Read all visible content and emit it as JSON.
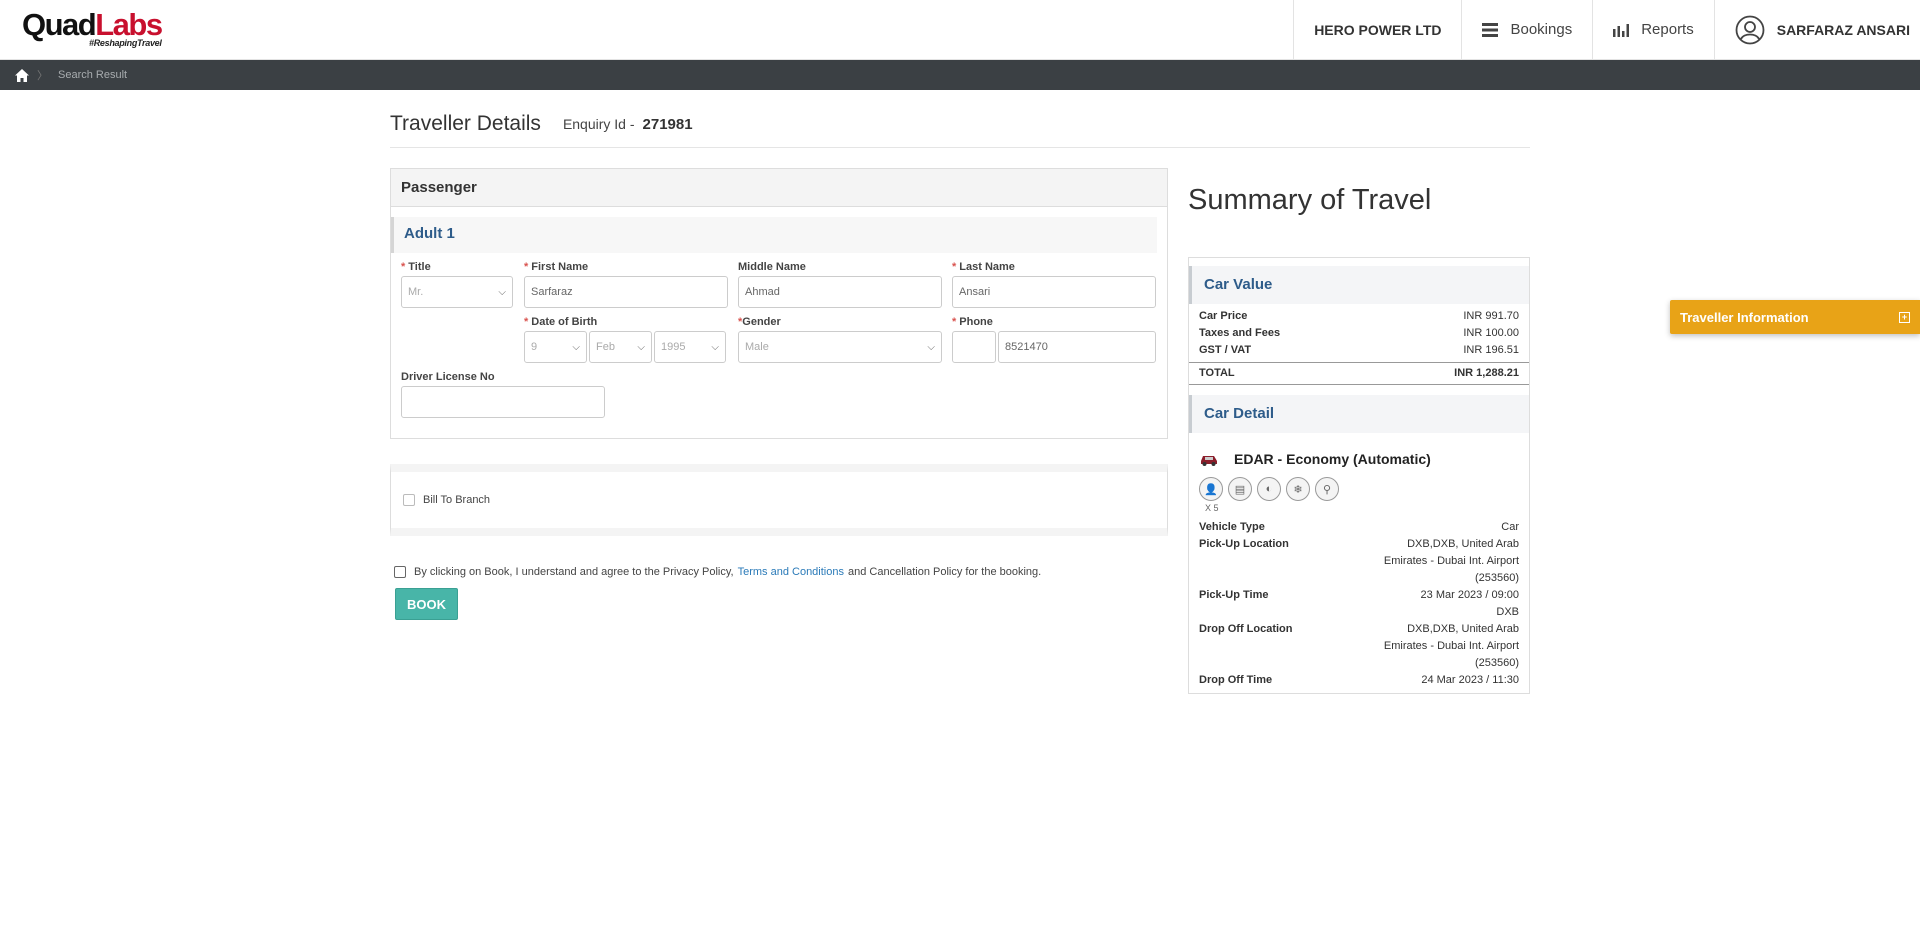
{
  "brand": {
    "logo_main": "Quad",
    "logo_accent": "Labs",
    "tagline": "#ReshapingTravel"
  },
  "nav": {
    "company": "HERO POWER LTD",
    "bookings": "Bookings",
    "reports": "Reports",
    "user": "SARFARAZ ANSARI"
  },
  "breadcrumb": {
    "current": "Search Result"
  },
  "header": {
    "title": "Traveller Details",
    "enquiry_label": "Enquiry Id -",
    "enquiry_id": "271981"
  },
  "passenger": {
    "section_title": "Passenger",
    "adult_label": "Adult 1",
    "title_label": "Title",
    "title_value": "Mr.",
    "first_name_label": "First Name",
    "first_name": "Sarfaraz",
    "middle_name_label": "Middle Name",
    "middle_name": "Ahmad",
    "last_name_label": "Last Name",
    "last_name": "Ansari",
    "dob_label": "Date of Birth",
    "dob_day": "9",
    "dob_month": "Feb",
    "dob_year": "1995",
    "gender_label": "Gender",
    "gender_value": "Male",
    "phone_label": "Phone",
    "phone_code": "",
    "phone": "8521470",
    "license_label": "Driver License No",
    "license_value": ""
  },
  "billing": {
    "bill_to_branch": "Bill To Branch"
  },
  "agreement": {
    "prefix": "By clicking on Book, I understand and agree to the Privacy Policy,",
    "link": "Terms and Conditions",
    "suffix": "and Cancellation Policy for the booking."
  },
  "actions": {
    "book": "BOOK"
  },
  "summary": {
    "title": "Summary of Travel",
    "car_value_title": "Car Value",
    "price_rows": [
      {
        "label": "Car Price",
        "value": "INR 991.70"
      },
      {
        "label": "Taxes and Fees",
        "value": "INR 100.00"
      },
      {
        "label": "GST / VAT",
        "value": "INR 196.51"
      }
    ],
    "total_label": "TOTAL",
    "total_value": "INR 1,288.21",
    "car_detail_title": "Car Detail",
    "car_name": "EDAR - Economy (Automatic)",
    "passenger_count": "X 5",
    "details": [
      {
        "label": "Vehicle Type",
        "value": "Car"
      },
      {
        "label": "Pick-Up Location",
        "value": "DXB,DXB, United Arab Emirates - Dubai Int. Airport (253560)"
      },
      {
        "label": "Pick-Up Time",
        "value": "23 Mar 2023 / 09:00 DXB"
      },
      {
        "label": "Drop Off Location",
        "value": "DXB,DXB, United Arab Emirates - Dubai Int. Airport (253560)"
      },
      {
        "label": "Drop Off Time",
        "value": "24 Mar 2023 / 11:30"
      }
    ]
  },
  "side_tab": {
    "label": "Traveller Information"
  }
}
